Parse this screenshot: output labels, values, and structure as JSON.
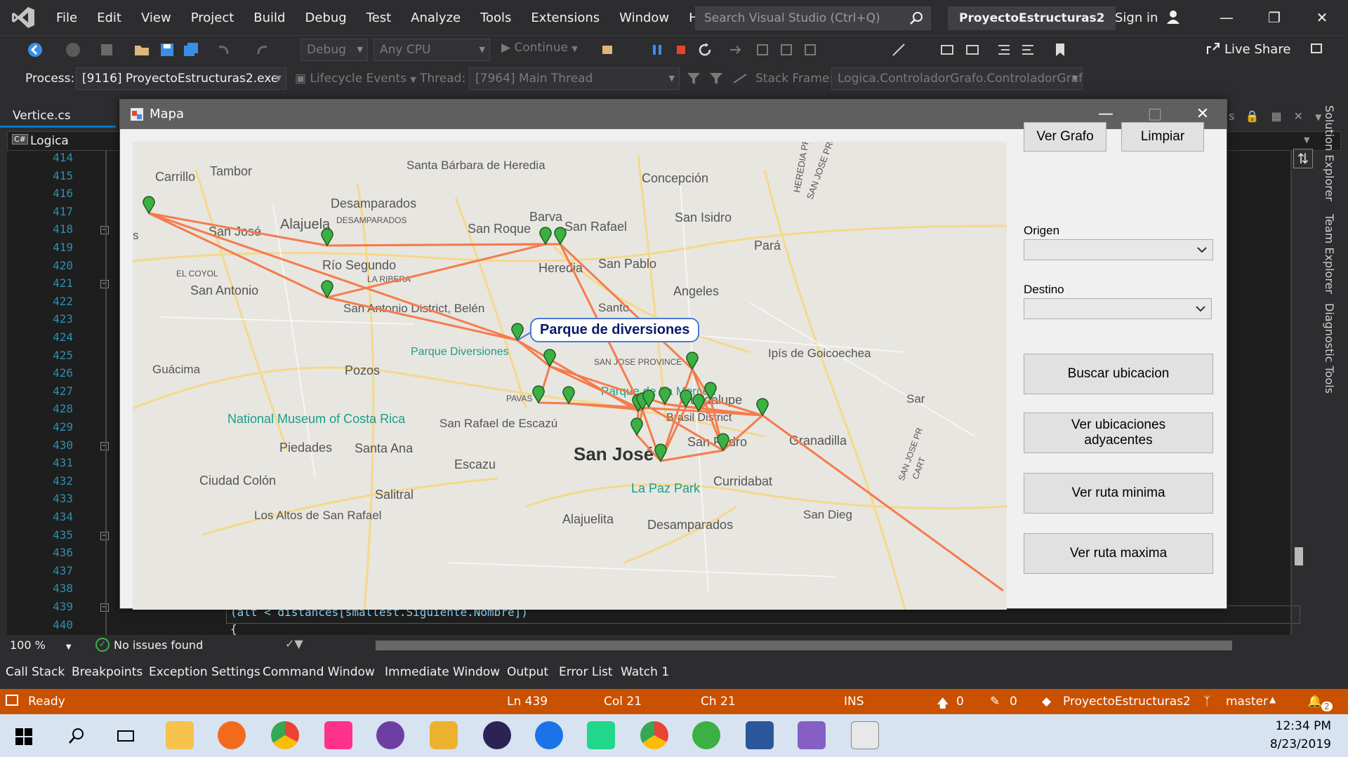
{
  "titlebar": {
    "menu": [
      "File",
      "Edit",
      "View",
      "Project",
      "Build",
      "Debug",
      "Test",
      "Analyze",
      "Tools",
      "Extensions",
      "Window",
      "Help"
    ],
    "search_placeholder": "Search Visual Studio (Ctrl+Q)",
    "solution_name": "ProyectoEstructuras2",
    "sign_in": "Sign in"
  },
  "toolbar": {
    "configuration": "Debug",
    "platform": "Any CPU",
    "continue_label": "Continue",
    "live_share": "Live Share"
  },
  "processbar": {
    "process_label": "Process:",
    "process_value": "[9116] ProyectoEstructuras2.exe",
    "lifecycle_label": "Lifecycle Events",
    "thread_label": "Thread:",
    "thread_value": "[7964] Main Thread",
    "stackframe_label": "Stack Frame:",
    "stackframe_value": "Logica.ControladorGrafo.ControladorGraf"
  },
  "editor": {
    "tab": "Vertice.cs",
    "nav_project": "Logica",
    "line_numbers": [
      "414",
      "415",
      "416",
      "417",
      "418",
      "419",
      "420",
      "421",
      "422",
      "423",
      "424",
      "425",
      "426",
      "427",
      "428",
      "429",
      "430",
      "431",
      "432",
      "433",
      "434",
      "435",
      "436",
      "437",
      "438",
      "439",
      "440"
    ],
    "code_line_439": "(alt < distances[smallest.Siguiente.Nombre])",
    "code_line_440": "{",
    "zoom": "100 %",
    "issues": "No issues found"
  },
  "right_panels": [
    "Solution Explorer",
    "Team Explorer",
    "Diagnostic Tools"
  ],
  "bottom_tabs": [
    "Call Stack",
    "Breakpoints",
    "Exception Settings",
    "Command Window",
    "Immediate Window",
    "Output",
    "Error List",
    "Watch 1"
  ],
  "statusbar": {
    "state": "Ready",
    "line": "Ln 439",
    "col": "Col 21",
    "ch": "Ch 21",
    "mode": "INS",
    "up_count": "0",
    "pencil_count": "0",
    "project": "ProyectoEstructuras2",
    "branch": "master",
    "notifications": "2"
  },
  "taskbar": {
    "time": "12:34 PM",
    "date": "8/23/2019"
  },
  "dialog": {
    "title": "Mapa",
    "buttons": {
      "ver_grafo": "Ver Grafo",
      "limpiar": "Limpiar",
      "buscar": "Buscar ubicacion",
      "adyacentes": "Ver ubicaciones adyacentes",
      "ruta_minima": "Ver ruta minima",
      "ruta_maxima": "Ver ruta maxima"
    },
    "origen_label": "Origen",
    "destino_label": "Destino",
    "tooltip": "Parque de diversiones",
    "map_labels": [
      "Carrillo",
      "Tambor",
      "Santa Bárbara de Heredia",
      "Concepción",
      "Desamparados",
      "Alajuela",
      "DESAMPARADOS",
      "Barva",
      "San Roque",
      "San Rafael",
      "San Isidro",
      "San José",
      "Río Segundo",
      "Heredia",
      "San Pablo",
      "Pará",
      "EL COYOL",
      "San Antonio",
      "LA RIBERA",
      "Angeles",
      "San Antonio District, Belén",
      "Santo",
      "HEREDIA PROVINCE",
      "Ipís de Goicoechea",
      "Guácima",
      "Parque Diversiones",
      "SAN JOSE PROVINCE",
      "Pozos",
      "Guadalupe",
      "PAVAS",
      "Parque de La Merced",
      "Brasil District",
      "National Museum of Costa Rica",
      "San Rafael de Escazú",
      "Granadilla",
      "Piedades",
      "Santa Ana",
      "San José",
      "San Pedro",
      "Escazu",
      "Curridabat",
      "Ciudad Colón",
      "Salitral",
      "La Paz Park",
      "Los Altos de San Rafael",
      "Alajuelita",
      "Desamparados",
      "San Dieg",
      "HEREDIA PROVINCE",
      "SAN JOSE PROVINCE",
      "s",
      "Sar",
      "SAN JOSE PR",
      "CART"
    ]
  },
  "colors": {
    "accent": "#007acc",
    "status_bar": "#ca5100",
    "graph_edge": "#f47c4c",
    "marker": "#3cb043"
  }
}
